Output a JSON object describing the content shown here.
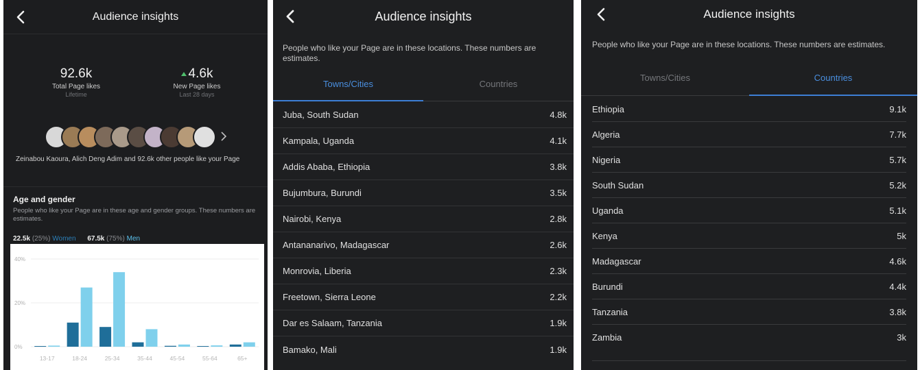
{
  "panel1": {
    "title": "Audience insights",
    "total_likes": {
      "value": "92.6k",
      "label": "Total Page likes",
      "sub": "Lifetime"
    },
    "new_likes": {
      "value": "4.6k",
      "label": "New Page likes",
      "sub": "Last 28 days"
    },
    "likers_text": "Zeinabou Kaoura, Alich Deng Adim and 92.6k other people like your Page",
    "age_gender": {
      "title": "Age and gender",
      "description": "People who like your Page are in these age and gender groups. These numbers are estimates.",
      "women_value": "22.5k",
      "women_pct": "(25%)",
      "women_label": "Women",
      "men_value": "67.5k",
      "men_pct": "(75%)",
      "men_label": "Men"
    },
    "avatar_colors": [
      "#d8d8d8",
      "#9a7b55",
      "#b88d5e",
      "#7d6a5a",
      "#a99a8a",
      "#5a4d44",
      "#c3b3c8",
      "#4b3b33",
      "#b69a78",
      "#e0e0e0"
    ]
  },
  "chart_data": {
    "type": "bar",
    "categories": [
      "13-17",
      "18-24",
      "25-34",
      "35-44",
      "45-54",
      "55-64",
      "65+"
    ],
    "series": [
      {
        "name": "Women",
        "color": "#1f6e99",
        "values": [
          0.3,
          11,
          9,
          2,
          0.4,
          0.3,
          1
        ]
      },
      {
        "name": "Men",
        "color": "#7fd0ec",
        "values": [
          0.5,
          27,
          34,
          8,
          1,
          0.6,
          2
        ]
      }
    ],
    "ytick_labels": [
      "40%",
      "20%",
      "0%"
    ],
    "yticks": [
      40,
      20,
      0
    ],
    "ylim": [
      0,
      40
    ]
  },
  "panel2": {
    "title": "Audience insights",
    "description": "People who like your Page are in these locations. These numbers are estimates.",
    "tabs": [
      "Towns/Cities",
      "Countries"
    ],
    "rows": [
      {
        "name": "Juba, South Sudan",
        "value": "4.8k"
      },
      {
        "name": "Kampala, Uganda",
        "value": "4.1k"
      },
      {
        "name": "Addis Ababa, Ethiopia",
        "value": "3.8k"
      },
      {
        "name": "Bujumbura, Burundi",
        "value": "3.5k"
      },
      {
        "name": "Nairobi, Kenya",
        "value": "2.8k"
      },
      {
        "name": "Antananarivo, Madagascar",
        "value": "2.6k"
      },
      {
        "name": "Monrovia, Liberia",
        "value": "2.3k"
      },
      {
        "name": "Freetown, Sierra Leone",
        "value": "2.2k"
      },
      {
        "name": "Dar es Salaam, Tanzania",
        "value": "1.9k"
      },
      {
        "name": "Bamako, Mali",
        "value": "1.9k"
      }
    ]
  },
  "panel3": {
    "title": "Audience insights",
    "description": "People who like your Page are in these locations. These numbers are estimates.",
    "tabs": [
      "Towns/Cities",
      "Countries"
    ],
    "rows": [
      {
        "name": "Ethiopia",
        "value": "9.1k"
      },
      {
        "name": "Algeria",
        "value": "7.7k"
      },
      {
        "name": "Nigeria",
        "value": "5.7k"
      },
      {
        "name": "South Sudan",
        "value": "5.2k"
      },
      {
        "name": "Uganda",
        "value": "5.1k"
      },
      {
        "name": "Kenya",
        "value": "5k"
      },
      {
        "name": "Madagascar",
        "value": "4.6k"
      },
      {
        "name": "Burundi",
        "value": "4.4k"
      },
      {
        "name": "Tanzania",
        "value": "3.8k"
      },
      {
        "name": "Zambia",
        "value": "3k"
      }
    ]
  }
}
